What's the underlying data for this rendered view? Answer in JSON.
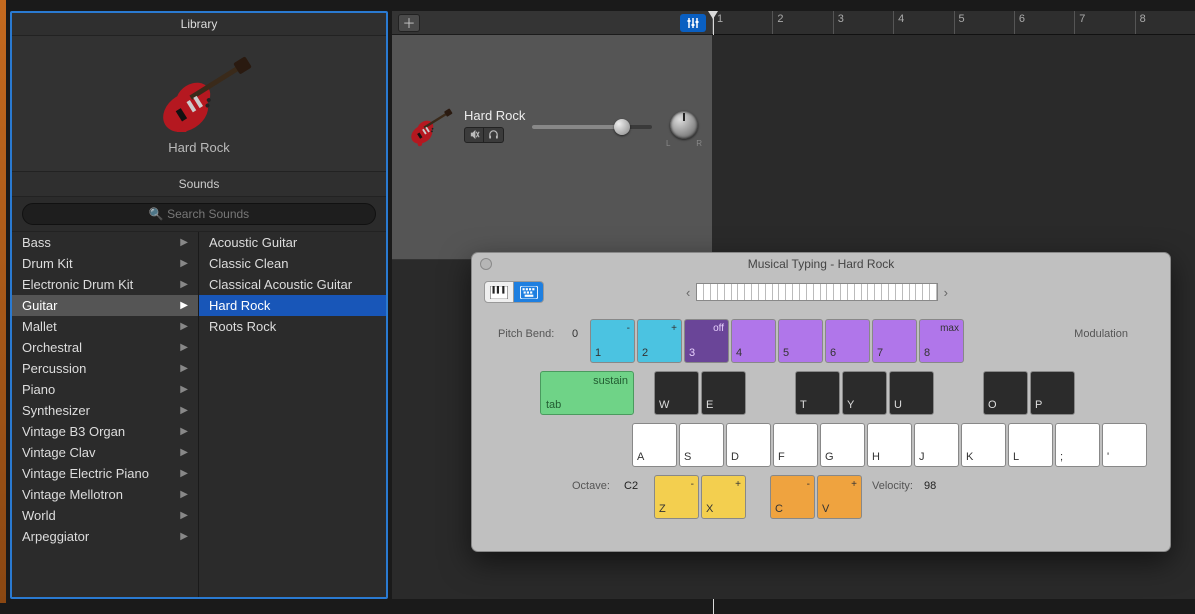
{
  "library": {
    "title": "Library",
    "preview_name": "Hard Rock",
    "sounds_header": "Sounds",
    "search_placeholder": "Search Sounds",
    "categories": [
      "Bass",
      "Drum Kit",
      "Electronic Drum Kit",
      "Guitar",
      "Mallet",
      "Orchestral",
      "Percussion",
      "Piano",
      "Synthesizer",
      "Vintage B3 Organ",
      "Vintage Clav",
      "Vintage Electric Piano",
      "Vintage Mellotron",
      "World",
      "Arpeggiator"
    ],
    "selected_category_index": 3,
    "patches": [
      "Acoustic Guitar",
      "Classic Clean",
      "Classical Acoustic Guitar",
      "Hard Rock",
      "Roots Rock"
    ],
    "selected_patch_index": 3
  },
  "track": {
    "name": "Hard Rock",
    "pan_left": "L",
    "pan_right": "R"
  },
  "ruler": {
    "bars": [
      "1",
      "2",
      "3",
      "4",
      "5",
      "6",
      "7",
      "8"
    ]
  },
  "mt": {
    "title": "Musical Typing - Hard Rock",
    "pitch_bend_label": "Pitch Bend:",
    "pitch_bend_value": "0",
    "modulation_label": "Modulation",
    "num_keys": [
      {
        "top": "-",
        "bot": "1",
        "cls": "k-cyan"
      },
      {
        "top": "+",
        "bot": "2",
        "cls": "k-cyan"
      },
      {
        "top": "off",
        "bot": "3",
        "cls": "k-purple-dark"
      },
      {
        "top": "",
        "bot": "4",
        "cls": "k-purple"
      },
      {
        "top": "",
        "bot": "5",
        "cls": "k-purple"
      },
      {
        "top": "",
        "bot": "6",
        "cls": "k-purple"
      },
      {
        "top": "",
        "bot": "7",
        "cls": "k-purple"
      },
      {
        "top": "max",
        "bot": "8",
        "cls": "k-purple"
      }
    ],
    "sustain_top": "sustain",
    "sustain_bot": "tab",
    "black_keys": [
      "W",
      "E",
      "",
      "T",
      "Y",
      "U",
      "",
      "O",
      "P"
    ],
    "white_keys": [
      "A",
      "S",
      "D",
      "F",
      "G",
      "H",
      "J",
      "K",
      "L",
      ";",
      "'"
    ],
    "octave_label": "Octave:",
    "octave_value": "C2",
    "velocity_label": "Velocity:",
    "velocity_value": "98",
    "oct_keys": [
      {
        "top": "-",
        "bot": "Z",
        "cls": "k-yellow"
      },
      {
        "top": "+",
        "bot": "X",
        "cls": "k-yellow"
      }
    ],
    "trans_keys": [
      {
        "top": "-",
        "bot": "C",
        "cls": "k-orange"
      },
      {
        "top": "+",
        "bot": "V",
        "cls": "k-orange"
      }
    ]
  }
}
